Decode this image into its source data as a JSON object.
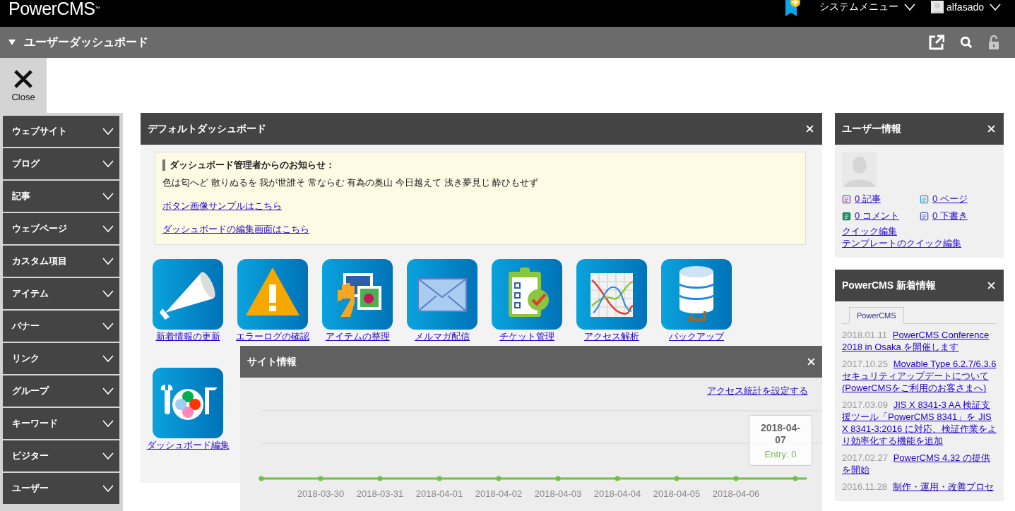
{
  "header": {
    "logo": "PowerCMS",
    "logo_mark": "™",
    "system_menu": "システムメニュー",
    "user": "alfasado"
  },
  "toolbar": {
    "title": "ユーザーダッシュボード"
  },
  "close_button": {
    "label": "Close"
  },
  "sidebar": {
    "items": [
      {
        "label": "ウェブサイト",
        "expanded": false
      },
      {
        "label": "ブログ",
        "expanded": false
      },
      {
        "label": "記事",
        "expanded": false
      },
      {
        "label": "ウェブページ",
        "expanded": false
      },
      {
        "label": "カスタム項目",
        "expanded": false
      },
      {
        "label": "アイテム",
        "expanded": false
      },
      {
        "label": "バナー",
        "expanded": false
      },
      {
        "label": "リンク",
        "expanded": false
      },
      {
        "label": "グループ",
        "expanded": false
      },
      {
        "label": "キーワード",
        "expanded": false
      },
      {
        "label": "ビジター",
        "expanded": false
      },
      {
        "label": "ユーザー",
        "expanded": false
      }
    ]
  },
  "main_panel": {
    "title": "デフォルトダッシュボード",
    "notice": {
      "heading": "ダッシュボード管理者からのお知らせ：",
      "body": "色は匂へど 散りぬるを 我が世誰そ 常ならむ 有為の奥山 今日越えて 浅き夢見じ 酔ひもせず",
      "links": [
        "ボタン画像サンプルはこちら",
        "ダッシュボードの編集画面はこちら"
      ]
    },
    "shortcuts": [
      {
        "kind": "megaphone",
        "label": "新着情報の更新"
      },
      {
        "kind": "warning",
        "label": "エラーログの確認"
      },
      {
        "kind": "pictures",
        "label": "アイテムの整理"
      },
      {
        "kind": "mail",
        "label": "メルマガ配信"
      },
      {
        "kind": "ticket",
        "label": "チケット管理"
      },
      {
        "kind": "chart",
        "label": "アクセス解析"
      },
      {
        "kind": "database",
        "label": "バックアップ"
      },
      {
        "kind": "tools",
        "label": "ダッシュボード編集"
      }
    ]
  },
  "user_panel": {
    "title": "ユーザー情報",
    "stats": [
      {
        "kind": "entry",
        "label": "0 記事"
      },
      {
        "kind": "page",
        "label": "0 ページ"
      },
      {
        "kind": "comment",
        "label": "0 コメント"
      },
      {
        "kind": "draft",
        "label": "0 下書き"
      }
    ],
    "links": [
      "クイック編集",
      "テンプレートのクイック編集"
    ]
  },
  "news_panel": {
    "title": "PowerCMS 新着情報",
    "tabs": [
      {
        "label": "PowerCMS",
        "selected": true
      }
    ],
    "items": [
      {
        "date": "2018.01.11",
        "title": "PowerCMS Conference 2018 in Osaka を開催します"
      },
      {
        "date": "2017.10.25",
        "title": "Movable Type 6.2.7/6.3.6 セキュリティアップデートについて (PowerCMSをご利用のお客さまへ)"
      },
      {
        "date": "2017.03.09",
        "title": "JIS X 8341-3 AA 検証支援ツール「PowerCMS 8341」を JIS X 8341-3:2016 に対応、検証作業をより効率化する機能を追加"
      },
      {
        "date": "2017.02.27",
        "title": "PowerCMS 4.32 の提供を開始"
      },
      {
        "date": "2016.11.28",
        "title": "制作・運用・改善プロセ"
      }
    ]
  },
  "site_info_panel": {
    "title": "サイト情報",
    "link": "アクセス統計を設定する",
    "x_labels": [
      "2018-03-30",
      "2018-03-31",
      "2018-04-01",
      "2018-04-02",
      "2018-04-03",
      "2018-04-04",
      "2018-04-05",
      "2018-04-06"
    ],
    "tooltip": {
      "date": "2018-04-07",
      "value": "Entry: 0"
    }
  }
}
